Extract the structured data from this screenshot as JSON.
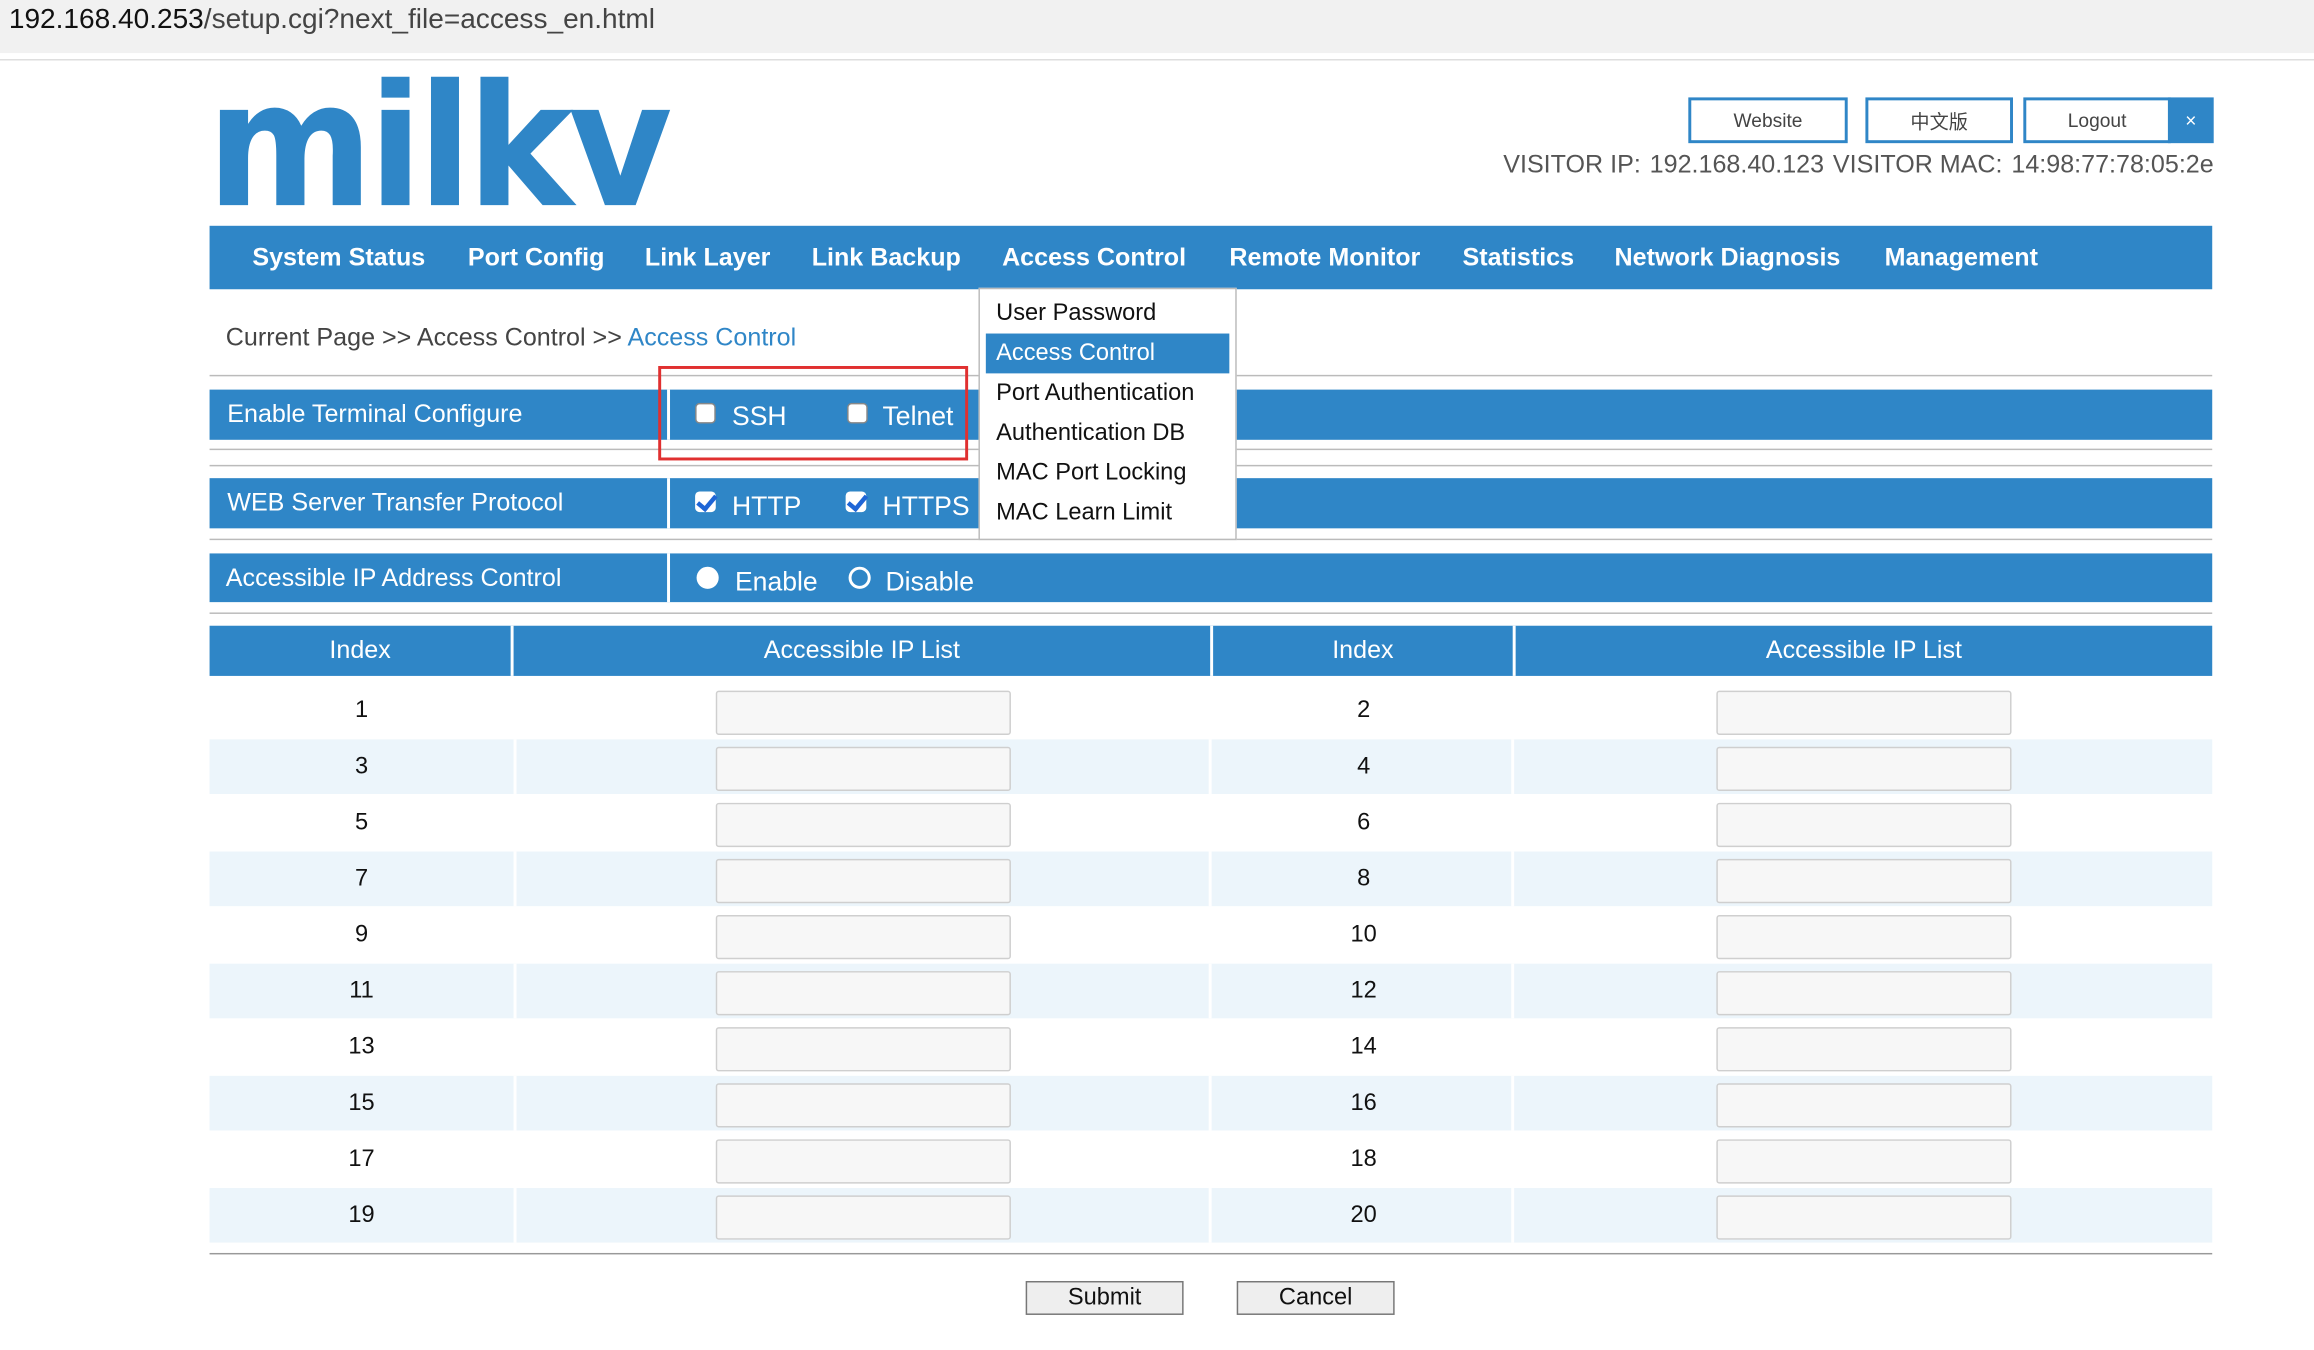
{
  "browser": {
    "url_host": "192.168.40.253",
    "url_path": "/setup.cgi?next_file=access_en.html"
  },
  "header": {
    "logo_text": "milkv",
    "buttons": {
      "website": "Website",
      "chinese": "中文版",
      "logout": "Logout",
      "close": "×"
    },
    "visitor_ip_label": "VISITOR IP:",
    "visitor_ip": "192.168.40.123",
    "visitor_mac_label": "VISITOR MAC:",
    "visitor_mac": "14:98:77:78:05:2e"
  },
  "nav": {
    "items": [
      "System Status",
      "Port Config",
      "Link Layer",
      "Link Backup",
      "Access Control",
      "Remote Monitor",
      "Statistics",
      "Network Diagnosis",
      "Management"
    ]
  },
  "dropdown": {
    "items": [
      "User Password",
      "Access Control",
      "Port Authentication",
      "Authentication DB",
      "MAC Port Locking",
      "MAC Learn Limit"
    ],
    "selected": "Access Control"
  },
  "breadcrumb": {
    "prefix": "Current Page >> Access Control >>",
    "current": "Access Control"
  },
  "terminal": {
    "label": "Enable Terminal Configure",
    "options": [
      {
        "label": "SSH",
        "checked": false
      },
      {
        "label": "Telnet",
        "checked": false
      }
    ]
  },
  "web": {
    "label": "WEB Server Transfer Protocol",
    "options": [
      {
        "label": "HTTP",
        "checked": true
      },
      {
        "label": "HTTPS",
        "checked": true
      }
    ]
  },
  "ipcontrol": {
    "label": "Accessible IP Address Control",
    "options": [
      {
        "label": "Enable",
        "selected": false
      },
      {
        "label": "Disable",
        "selected": true
      }
    ]
  },
  "table": {
    "headers": [
      "Index",
      "Accessible IP List",
      "Index",
      "Accessible IP List"
    ],
    "rows": [
      {
        "left_index": "1",
        "left_ip": "",
        "right_index": "2",
        "right_ip": ""
      },
      {
        "left_index": "3",
        "left_ip": "",
        "right_index": "4",
        "right_ip": ""
      },
      {
        "left_index": "5",
        "left_ip": "",
        "right_index": "6",
        "right_ip": ""
      },
      {
        "left_index": "7",
        "left_ip": "",
        "right_index": "8",
        "right_ip": ""
      },
      {
        "left_index": "9",
        "left_ip": "",
        "right_index": "10",
        "right_ip": ""
      },
      {
        "left_index": "11",
        "left_ip": "",
        "right_index": "12",
        "right_ip": ""
      },
      {
        "left_index": "13",
        "left_ip": "",
        "right_index": "14",
        "right_ip": ""
      },
      {
        "left_index": "15",
        "left_ip": "",
        "right_index": "16",
        "right_ip": ""
      },
      {
        "left_index": "17",
        "left_ip": "",
        "right_index": "18",
        "right_ip": ""
      },
      {
        "left_index": "19",
        "left_ip": "",
        "right_index": "20",
        "right_ip": ""
      }
    ]
  },
  "actions": {
    "submit": "Submit",
    "cancel": "Cancel"
  },
  "colors": {
    "accent": "#2f86c7",
    "highlight_box": "#e03030",
    "row_alt": "#ecf5fb"
  }
}
